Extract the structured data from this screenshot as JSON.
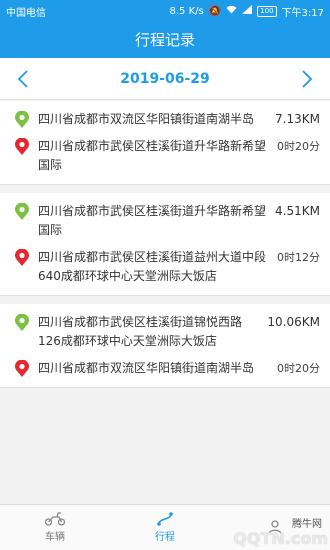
{
  "status_bar": {
    "carrier": "中国电信",
    "speed": "8.5 K/s",
    "battery": "100",
    "time": "下午3:17"
  },
  "header": {
    "title": "行程记录"
  },
  "date_nav": {
    "date": "2019-06-29"
  },
  "trips": [
    {
      "start": "四川省成都市双流区华阳镇街道南湖半岛",
      "distance": "7.13KM",
      "end": "四川省成都市武侯区桂溪街道升华路新希望国际",
      "duration": "0时20分"
    },
    {
      "start": "四川省成都市武侯区桂溪街道升华路新希望国际",
      "distance": "4.51KM",
      "end": "四川省成都市武侯区桂溪街道益州大道中段640成都环球中心天堂洲际大饭店",
      "duration": "0时12分"
    },
    {
      "start": "四川省成都市武侯区桂溪街道锦悦西路126成都环球中心天堂洲际大饭店",
      "distance": "10.06KM",
      "end": "四川省成都市双流区华阳镇街道南湖半岛",
      "duration": "0时20分"
    }
  ],
  "tabs": [
    {
      "label": "车辆"
    },
    {
      "label": "行程"
    },
    {
      "label": ""
    }
  ],
  "watermark": {
    "text": "QQTN.com",
    "small": "腾牛网"
  },
  "colors": {
    "primary": "#1e9be9",
    "start_pin": "#7cc142",
    "end_pin": "#e8262d"
  },
  "icons": {
    "start": "location-start-icon",
    "end": "location-end-icon",
    "prev": "chevron-left-icon",
    "next": "chevron-right-icon",
    "vehicle": "scooter-icon"
  }
}
